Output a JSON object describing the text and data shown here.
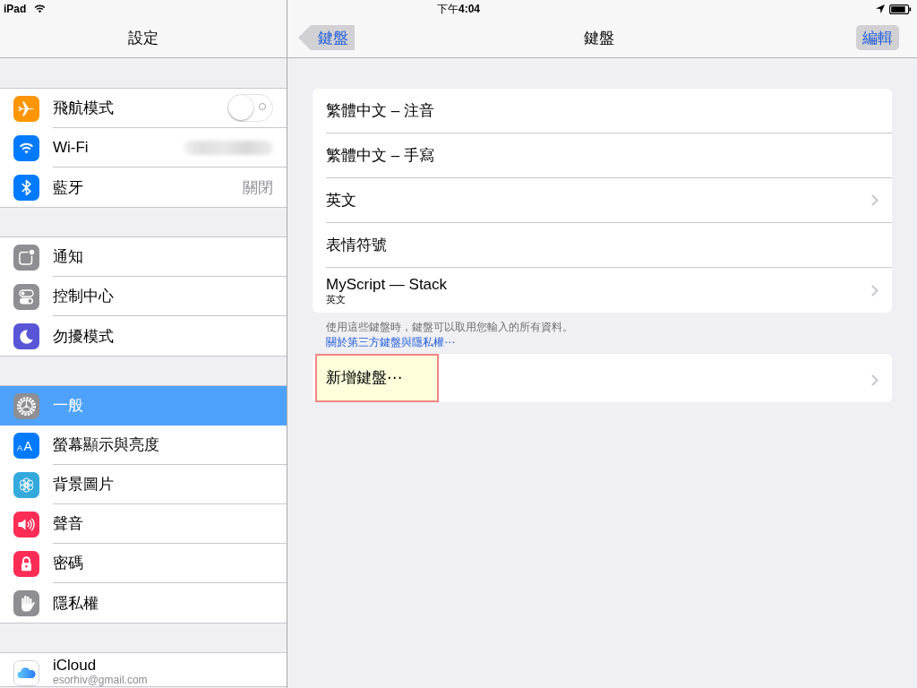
{
  "status_bar": {
    "device": "iPad",
    "time": "下午**4:04**"
  },
  "sidebar": {
    "title": "設定",
    "groups": [
      {
        "items": [
          {
            "label": "飛航模式",
            "kind": "toggle",
            "on": false,
            "selected": false
          },
          {
            "label": "Wi-Fi",
            "kind": "blurred",
            "selected": false
          },
          {
            "label": "藍牙",
            "kind": "value",
            "value": "關閉",
            "selected": false
          }
        ]
      },
      {
        "items": [
          {
            "label": "通知",
            "kind": "plain",
            "selected": false
          },
          {
            "label": "控制中心",
            "kind": "plain",
            "selected": false
          },
          {
            "label": "勿擾模式",
            "kind": "plain",
            "selected": false
          }
        ]
      },
      {
        "items": [
          {
            "label": "一般",
            "kind": "plain",
            "selected": true
          },
          {
            "label": "螢幕顯示與亮度",
            "kind": "plain",
            "icon_text": "AA",
            "selected": false
          },
          {
            "label": "背景圖片",
            "kind": "plain",
            "selected": false
          },
          {
            "label": "聲音",
            "kind": "plain",
            "selected": false
          },
          {
            "label": "密碼",
            "kind": "plain",
            "selected": false
          },
          {
            "label": "隱私權",
            "kind": "plain",
            "selected": false
          }
        ]
      },
      {
        "items": [
          {
            "label": "iCloud",
            "kind": "account",
            "subtitle": "esorhiv@gmail.com",
            "selected": false
          }
        ]
      }
    ]
  },
  "detail": {
    "back_button": "鍵盤",
    "title": "鍵盤",
    "edit_button": "編輯",
    "keyboards": [
      {
        "label": "繁體中文 – 注音",
        "chevron": false
      },
      {
        "label": "繁體中文 – 手寫",
        "chevron": false
      },
      {
        "label": "英文",
        "chevron": true
      },
      {
        "label": "表情符號",
        "chevron": false
      },
      {
        "label": "MyScript — Stack",
        "subtitle": "英文",
        "chevron": true
      }
    ],
    "footer": {
      "text": "使用這些鍵盤時，鍵盤可以取用您輸入的所有資料。",
      "link": "關於第三方鍵盤與隱私權⋯"
    },
    "add_keyboard": [
      {
        "label": "新增鍵盤⋯",
        "chevron": true,
        "highlighted": true
      }
    ]
  }
}
